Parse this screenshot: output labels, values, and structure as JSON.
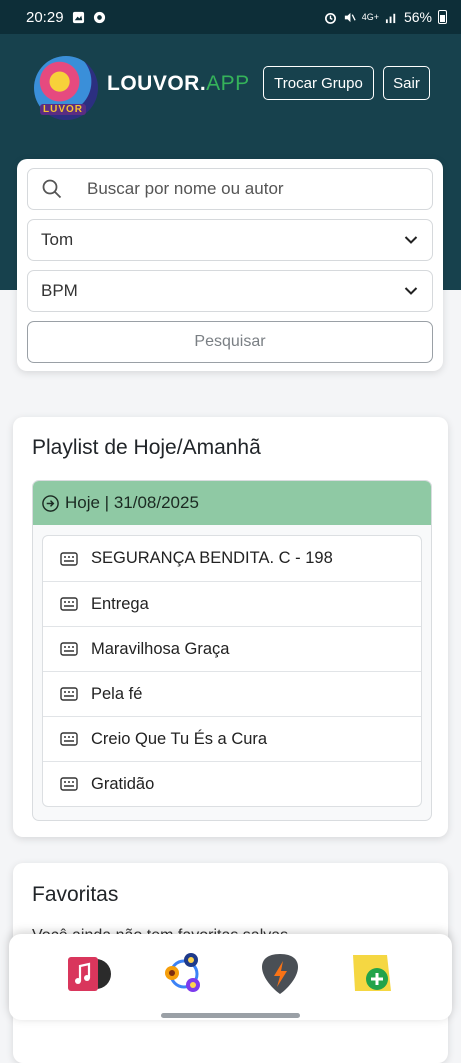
{
  "status_bar": {
    "time": "20:29",
    "battery": "56%",
    "network": "4G+"
  },
  "header": {
    "logo_text": "LUVOR",
    "brand_main": "LOUVOR.",
    "brand_accent": "APP",
    "change_group_label": "Trocar Grupo",
    "logout_label": "Sair"
  },
  "search": {
    "placeholder": "Buscar por nome ou autor",
    "tom_label": "Tom",
    "bpm_label": "BPM",
    "submit_label": "Pesquisar"
  },
  "playlist": {
    "title": "Playlist de Hoje/Amanhã",
    "day_label": "Hoje | 31/08/2025",
    "songs": [
      "SEGURANÇA BENDITA. C - 198",
      "Entrega",
      "Maravilhosa Graça",
      "Pela fé",
      "Creio Que Tu És a Cura",
      "Gratidão"
    ]
  },
  "favorites": {
    "title": "Favoritas",
    "text": "Você ainda não tem favoritas salvas"
  },
  "nav": {
    "items": [
      "music-library-icon",
      "groups-icon",
      "guitar-pick-icon",
      "add-note-icon"
    ]
  },
  "colors": {
    "header_bg": "#17414d",
    "brand_accent": "#35b35a",
    "day_header_bg": "#8fc9a4"
  }
}
